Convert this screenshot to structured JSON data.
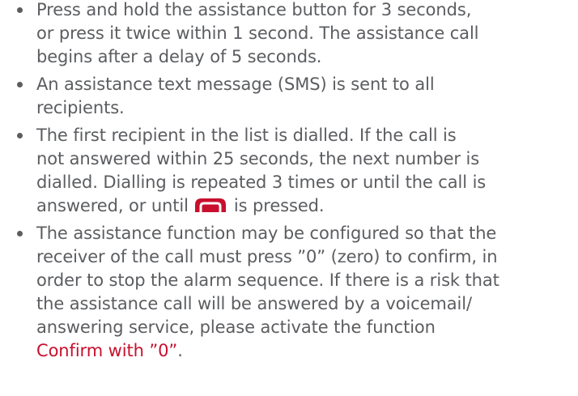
{
  "items": [
    {
      "lines": [
        "Press and hold the assistance button for 3 seconds,",
        "or press it twice within 1 second. The assistance call",
        "begins after a delay of 5 seconds."
      ]
    },
    {
      "lines": [
        "An assistance text message (SMS) is sent to all",
        "recipients."
      ]
    },
    {
      "lines": [
        "The first recipient in the list is dialled. If the call is",
        "not answered within 25 seconds, the next number is",
        "dialled. Dialling is repeated 3 times or until the call is"
      ],
      "last_line_before_icon": "answered, or until",
      "icon": "end-call-key-icon",
      "last_line_after_icon": "is pressed."
    },
    {
      "lines": [
        "The assistance function may be configured so that the",
        "receiver of the call must press ”0” (zero) to confirm, in",
        "order to stop the alarm sequence. If there is a risk that",
        "the assistance call will be answered by a voicemail/",
        "answering service, please activate the function"
      ],
      "highlight": "Confirm with ”0”",
      "highlight_suffix": "."
    }
  ],
  "colors": {
    "text": "#5b5d60",
    "accent": "#c8102e"
  }
}
